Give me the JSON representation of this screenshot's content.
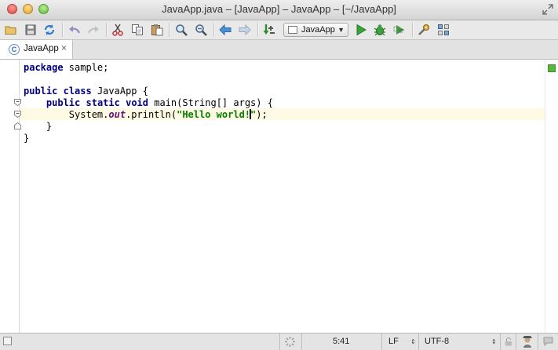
{
  "window": {
    "title": "JavaApp.java – [JavaApp] – JavaApp – [~/JavaApp]"
  },
  "toolbar": {
    "run_config_label": "JavaApp"
  },
  "tabs": [
    {
      "label": "JavaApp",
      "file_type_letter": "C",
      "active": true
    }
  ],
  "editor": {
    "code": {
      "l1_kw": "package",
      "l1_rest": " sample;",
      "l3_kw1": "public",
      "l3_kw2": "class",
      "l3_rest": " JavaApp {",
      "l4_kw1": "public",
      "l4_kw2": "static",
      "l4_kw3": "void",
      "l4_rest": " main(String[] args) {",
      "l5_a": "System.",
      "l5_field": "out",
      "l5_b": ".println(",
      "l5_str_a": "\"Hello world!",
      "l5_str_b": "\"",
      "l5_c": ");",
      "l6": "}",
      "l7": "}"
    },
    "current_line": 5,
    "inspection_status_color": "#58b540"
  },
  "statusbar": {
    "position": "5:41",
    "line_separator": "LF",
    "encoding": "UTF-8"
  },
  "colors": {
    "keyword": "#000080",
    "string": "#008000",
    "static_field": "#660e7a",
    "current_line_bg": "#fffae3"
  }
}
